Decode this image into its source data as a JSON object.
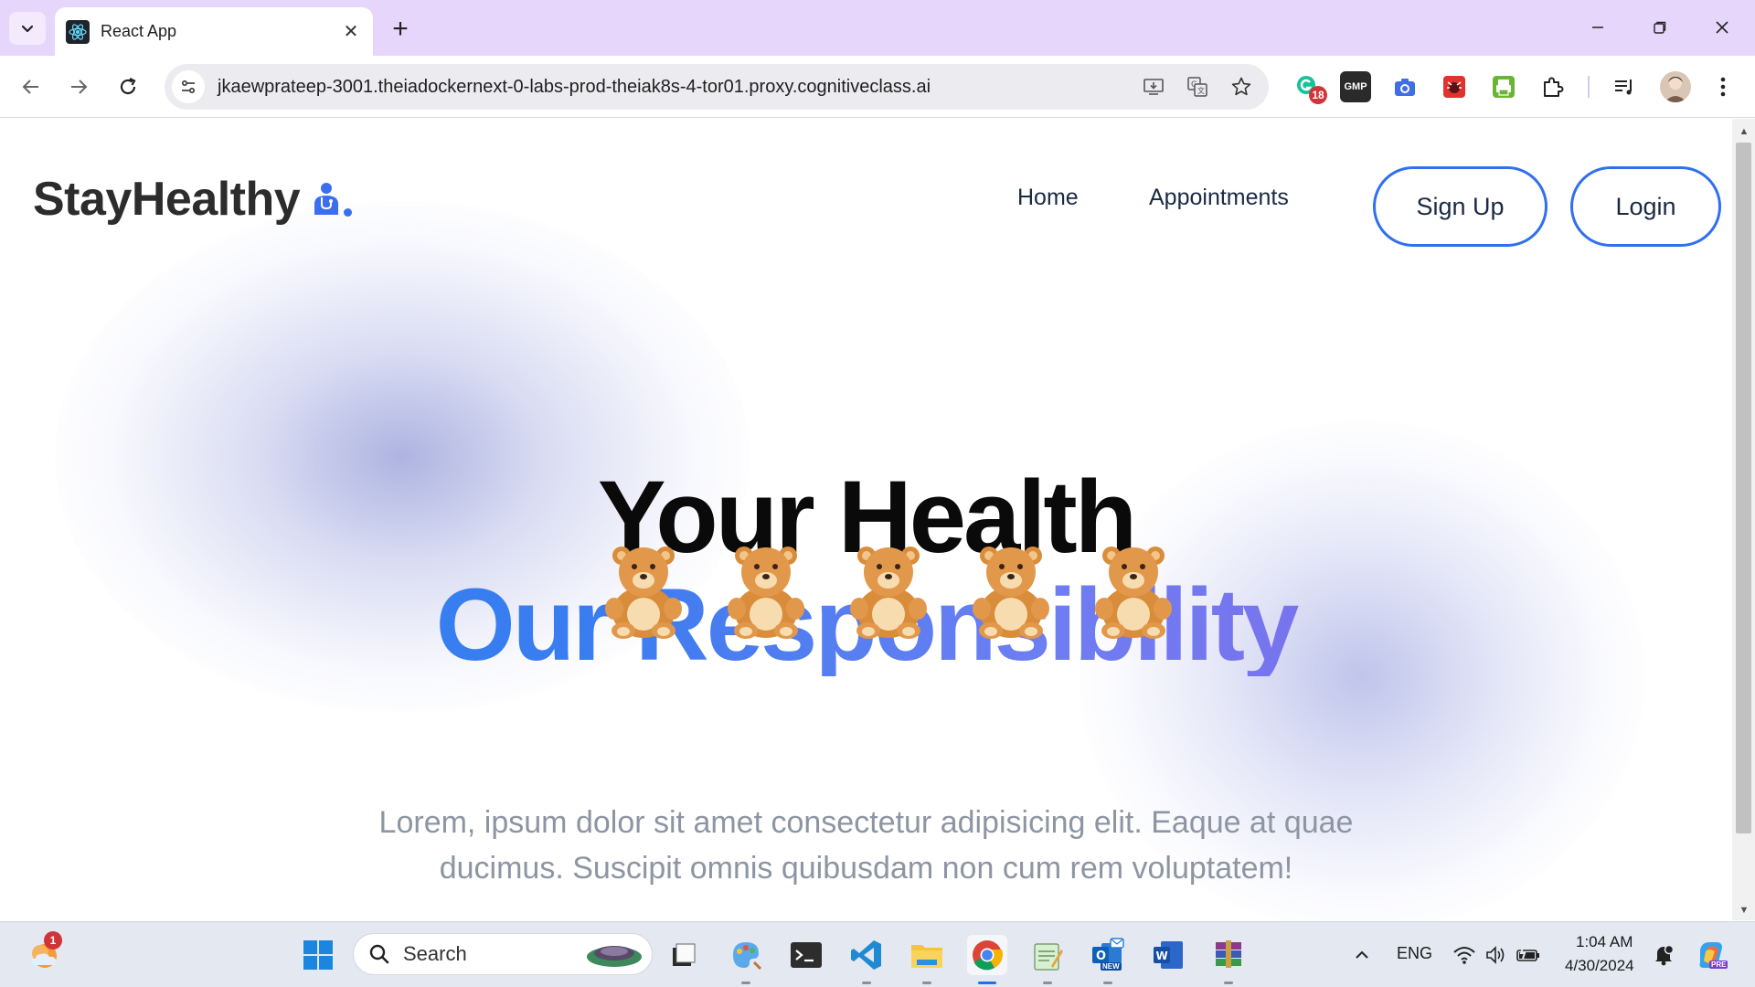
{
  "browser": {
    "tab_title": "React App",
    "url": "jkaewprateep-3001.theiadockernext-0-labs-prod-theiak8s-4-tor01.proxy.cognitiveclass.ai",
    "extension_badge": "18",
    "extension_gmp_label": "GMP"
  },
  "page": {
    "logo_text": "StayHealthy",
    "nav": {
      "home": "Home",
      "appointments": "Appointments",
      "signup": "Sign Up",
      "login": "Login"
    },
    "hero": {
      "line1": "Your Health",
      "line2": "Our Responsibility",
      "bear_count": 5
    },
    "description": "Lorem, ipsum dolor sit amet consectetur adipisicing elit. Eaque at quae ducimus. Suscipit omnis quibusdam non cum rem voluptatem!",
    "colors": {
      "accent": "#2f6ff0",
      "gradient_start": "#2b7ff0",
      "gradient_end": "#8a63e6",
      "tab_strip": "#e7d6fb"
    }
  },
  "taskbar": {
    "search_placeholder": "Search",
    "weather_badge": "1",
    "language": "ENG",
    "time": "1:04 AM",
    "date": "4/30/2024",
    "outlook_new_label": "NEW",
    "copilot_label": "PRE"
  }
}
